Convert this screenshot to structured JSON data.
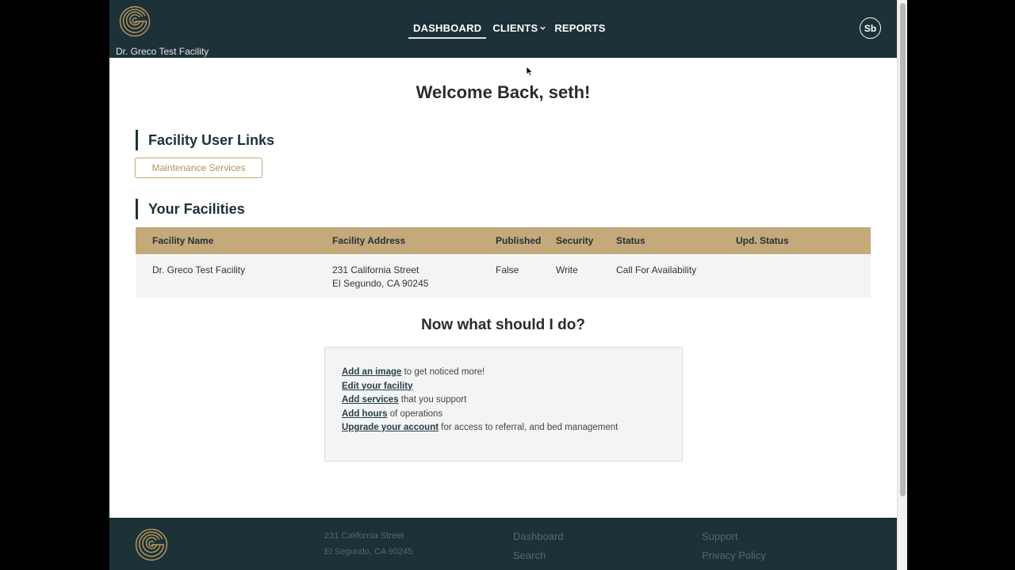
{
  "header": {
    "facility_name": "Dr. Greco Test Facility",
    "nav": {
      "dashboard": "DASHBOARD",
      "clients": "CLIENTS",
      "reports": "REPORTS"
    },
    "avatar_initials": "Sb"
  },
  "main": {
    "welcome": "Welcome Back, seth!",
    "links_heading": "Facility User Links",
    "maintenance_button": "Maintenance Services",
    "facilities_heading": "Your Facilities",
    "table": {
      "headers": [
        "Facility Name",
        "Facility Address",
        "Published",
        "Security",
        "Status",
        "Upd. Status"
      ],
      "rows": [
        {
          "name": "Dr. Greco Test Facility",
          "address_line1": "231 California Street",
          "address_line2": "El Segundo, CA 90245",
          "published": "False",
          "security": "Write",
          "status": "Call For Availability",
          "upd_status": ""
        }
      ]
    },
    "now_title": "Now what should I do?",
    "todo": [
      {
        "link": "Add an image",
        "text": " to get noticed more!"
      },
      {
        "link": "Edit your facility",
        "text": ""
      },
      {
        "link": "Add services",
        "text": " that you support"
      },
      {
        "link": "Add hours",
        "text": " of operations"
      },
      {
        "link": "Upgrade your account",
        "text": " for access to referral, and bed management"
      }
    ]
  },
  "footer": {
    "address_line1": "231 California Street",
    "address_line2": "El Segundo, CA 90245",
    "links": {
      "dashboard": "Dashboard",
      "search": "Search",
      "support": "Support",
      "privacy": "Privacy Policy"
    }
  },
  "colors": {
    "header_bg": "#1c3138",
    "gold": "#c4a97a",
    "logo_gold": "#b8995a"
  },
  "icons": {
    "logo": "g-circle-logo-icon",
    "clients_dropdown": "chevron-down-icon",
    "cursor": "mouse-pointer-icon"
  }
}
